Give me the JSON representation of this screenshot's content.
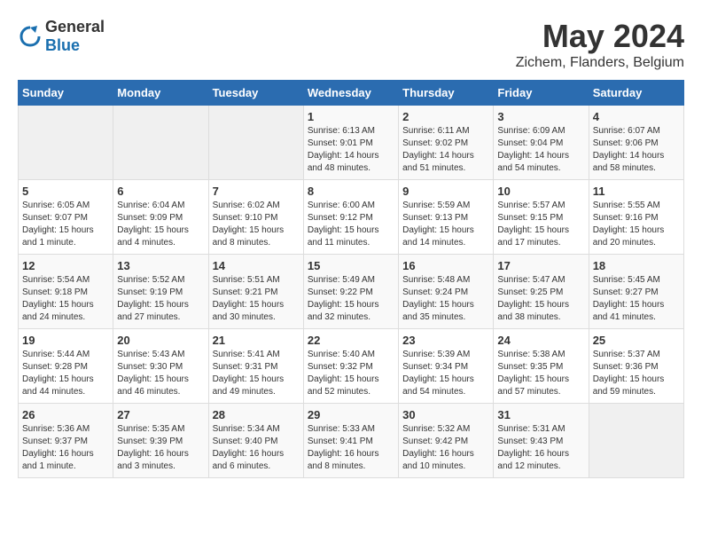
{
  "header": {
    "logo_general": "General",
    "logo_blue": "Blue",
    "month": "May 2024",
    "location": "Zichem, Flanders, Belgium"
  },
  "days_of_week": [
    "Sunday",
    "Monday",
    "Tuesday",
    "Wednesday",
    "Thursday",
    "Friday",
    "Saturday"
  ],
  "weeks": [
    [
      {
        "day": "",
        "details": ""
      },
      {
        "day": "",
        "details": ""
      },
      {
        "day": "",
        "details": ""
      },
      {
        "day": "1",
        "details": "Sunrise: 6:13 AM\nSunset: 9:01 PM\nDaylight: 14 hours\nand 48 minutes."
      },
      {
        "day": "2",
        "details": "Sunrise: 6:11 AM\nSunset: 9:02 PM\nDaylight: 14 hours\nand 51 minutes."
      },
      {
        "day": "3",
        "details": "Sunrise: 6:09 AM\nSunset: 9:04 PM\nDaylight: 14 hours\nand 54 minutes."
      },
      {
        "day": "4",
        "details": "Sunrise: 6:07 AM\nSunset: 9:06 PM\nDaylight: 14 hours\nand 58 minutes."
      }
    ],
    [
      {
        "day": "5",
        "details": "Sunrise: 6:05 AM\nSunset: 9:07 PM\nDaylight: 15 hours\nand 1 minute."
      },
      {
        "day": "6",
        "details": "Sunrise: 6:04 AM\nSunset: 9:09 PM\nDaylight: 15 hours\nand 4 minutes."
      },
      {
        "day": "7",
        "details": "Sunrise: 6:02 AM\nSunset: 9:10 PM\nDaylight: 15 hours\nand 8 minutes."
      },
      {
        "day": "8",
        "details": "Sunrise: 6:00 AM\nSunset: 9:12 PM\nDaylight: 15 hours\nand 11 minutes."
      },
      {
        "day": "9",
        "details": "Sunrise: 5:59 AM\nSunset: 9:13 PM\nDaylight: 15 hours\nand 14 minutes."
      },
      {
        "day": "10",
        "details": "Sunrise: 5:57 AM\nSunset: 9:15 PM\nDaylight: 15 hours\nand 17 minutes."
      },
      {
        "day": "11",
        "details": "Sunrise: 5:55 AM\nSunset: 9:16 PM\nDaylight: 15 hours\nand 20 minutes."
      }
    ],
    [
      {
        "day": "12",
        "details": "Sunrise: 5:54 AM\nSunset: 9:18 PM\nDaylight: 15 hours\nand 24 minutes."
      },
      {
        "day": "13",
        "details": "Sunrise: 5:52 AM\nSunset: 9:19 PM\nDaylight: 15 hours\nand 27 minutes."
      },
      {
        "day": "14",
        "details": "Sunrise: 5:51 AM\nSunset: 9:21 PM\nDaylight: 15 hours\nand 30 minutes."
      },
      {
        "day": "15",
        "details": "Sunrise: 5:49 AM\nSunset: 9:22 PM\nDaylight: 15 hours\nand 32 minutes."
      },
      {
        "day": "16",
        "details": "Sunrise: 5:48 AM\nSunset: 9:24 PM\nDaylight: 15 hours\nand 35 minutes."
      },
      {
        "day": "17",
        "details": "Sunrise: 5:47 AM\nSunset: 9:25 PM\nDaylight: 15 hours\nand 38 minutes."
      },
      {
        "day": "18",
        "details": "Sunrise: 5:45 AM\nSunset: 9:27 PM\nDaylight: 15 hours\nand 41 minutes."
      }
    ],
    [
      {
        "day": "19",
        "details": "Sunrise: 5:44 AM\nSunset: 9:28 PM\nDaylight: 15 hours\nand 44 minutes."
      },
      {
        "day": "20",
        "details": "Sunrise: 5:43 AM\nSunset: 9:30 PM\nDaylight: 15 hours\nand 46 minutes."
      },
      {
        "day": "21",
        "details": "Sunrise: 5:41 AM\nSunset: 9:31 PM\nDaylight: 15 hours\nand 49 minutes."
      },
      {
        "day": "22",
        "details": "Sunrise: 5:40 AM\nSunset: 9:32 PM\nDaylight: 15 hours\nand 52 minutes."
      },
      {
        "day": "23",
        "details": "Sunrise: 5:39 AM\nSunset: 9:34 PM\nDaylight: 15 hours\nand 54 minutes."
      },
      {
        "day": "24",
        "details": "Sunrise: 5:38 AM\nSunset: 9:35 PM\nDaylight: 15 hours\nand 57 minutes."
      },
      {
        "day": "25",
        "details": "Sunrise: 5:37 AM\nSunset: 9:36 PM\nDaylight: 15 hours\nand 59 minutes."
      }
    ],
    [
      {
        "day": "26",
        "details": "Sunrise: 5:36 AM\nSunset: 9:37 PM\nDaylight: 16 hours\nand 1 minute."
      },
      {
        "day": "27",
        "details": "Sunrise: 5:35 AM\nSunset: 9:39 PM\nDaylight: 16 hours\nand 3 minutes."
      },
      {
        "day": "28",
        "details": "Sunrise: 5:34 AM\nSunset: 9:40 PM\nDaylight: 16 hours\nand 6 minutes."
      },
      {
        "day": "29",
        "details": "Sunrise: 5:33 AM\nSunset: 9:41 PM\nDaylight: 16 hours\nand 8 minutes."
      },
      {
        "day": "30",
        "details": "Sunrise: 5:32 AM\nSunset: 9:42 PM\nDaylight: 16 hours\nand 10 minutes."
      },
      {
        "day": "31",
        "details": "Sunrise: 5:31 AM\nSunset: 9:43 PM\nDaylight: 16 hours\nand 12 minutes."
      },
      {
        "day": "",
        "details": ""
      }
    ]
  ]
}
